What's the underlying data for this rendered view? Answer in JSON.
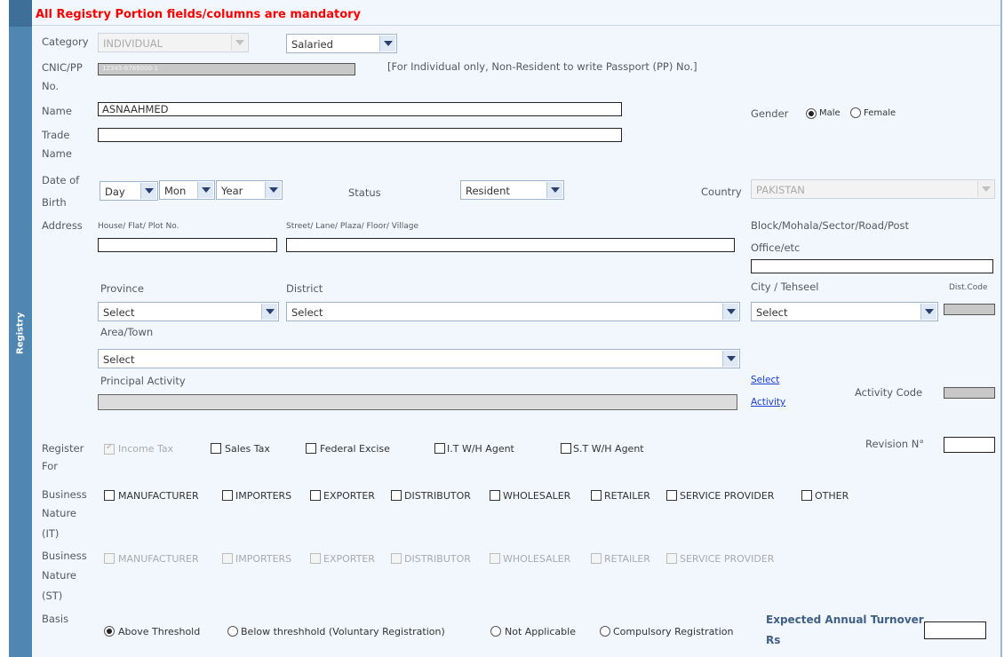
{
  "heading": "All Registry Portion fields/columns are mandatory",
  "sidebar_label": "Registry",
  "category": {
    "label": "Category",
    "value": "INDIVIDUAL",
    "type_value": "Salaried"
  },
  "cnic": {
    "label_line1": "CNIC/PP",
    "label_line2": "No.",
    "value": "12345-6789000-1",
    "hint": "[For Individual only, Non-Resident to write Passport (PP) No.]"
  },
  "name": {
    "label": "Name",
    "value": "ASNAAHMED"
  },
  "trade_name": {
    "label_line1": "Trade",
    "label_line2": "Name",
    "value": ""
  },
  "gender": {
    "label": "Gender",
    "male": "Male",
    "female": "Female"
  },
  "dob": {
    "label_line1": "Date of",
    "label_line2": "Birth",
    "day": "Day",
    "month": "Mon",
    "year": "Year"
  },
  "status": {
    "label": "Status",
    "value": "Resident"
  },
  "country": {
    "label": "Country",
    "value": "PAKISTAN"
  },
  "address": {
    "label": "Address",
    "house_label": "House/ Flat/ Plot No.",
    "street_label": "Street/ Lane/ Plaza/ Floor/ Village",
    "block_label_line1": "Block/Mohala/Sector/Road/Post",
    "block_label_line2": "Office/etc"
  },
  "province": {
    "label": "Province",
    "value": "Select"
  },
  "district": {
    "label": "District",
    "value": "Select"
  },
  "city": {
    "label": "City / Tehseel",
    "value": "Select"
  },
  "dist_code": {
    "label": "Dist.Code"
  },
  "area": {
    "label": "Area/Town",
    "value": "Select"
  },
  "principal_activity": {
    "label": "Principal Activity"
  },
  "select_activity": {
    "line1": "Select",
    "line2": "Activity"
  },
  "activity_code": {
    "label": "Activity Code"
  },
  "register_for": {
    "label_line1": "Register",
    "label_line2": "For",
    "options": [
      "Income Tax",
      "Sales Tax",
      "Federal Excise",
      "I.T W/H Agent",
      "S.T W/H Agent"
    ]
  },
  "revision": {
    "label": "Revision N°"
  },
  "business_it": {
    "label_lines": [
      "Business",
      "Nature",
      "(IT)"
    ],
    "options": [
      "MANUFACTURER",
      "IMPORTERS",
      "EXPORTER",
      "DISTRIBUTOR",
      "WHOLESALER",
      "RETAILER",
      "SERVICE PROVIDER",
      "OTHER"
    ]
  },
  "business_st": {
    "label_lines": [
      "Business",
      "Nature",
      "(ST)"
    ],
    "options": [
      "MANUFACTURER",
      "IMPORTERS",
      "EXPORTER",
      "DISTRIBUTOR",
      "WHOLESALER",
      "RETAILER",
      "SERVICE PROVIDER"
    ]
  },
  "basis": {
    "label": "Basis",
    "options": [
      "Above Threshold",
      "Below threshhold (Voluntary Registration)",
      "Not Applicable",
      "Compulsory Registration"
    ]
  },
  "turnover": {
    "label_line1": "Expected Annual Turnover",
    "label_line2": "Rs"
  }
}
